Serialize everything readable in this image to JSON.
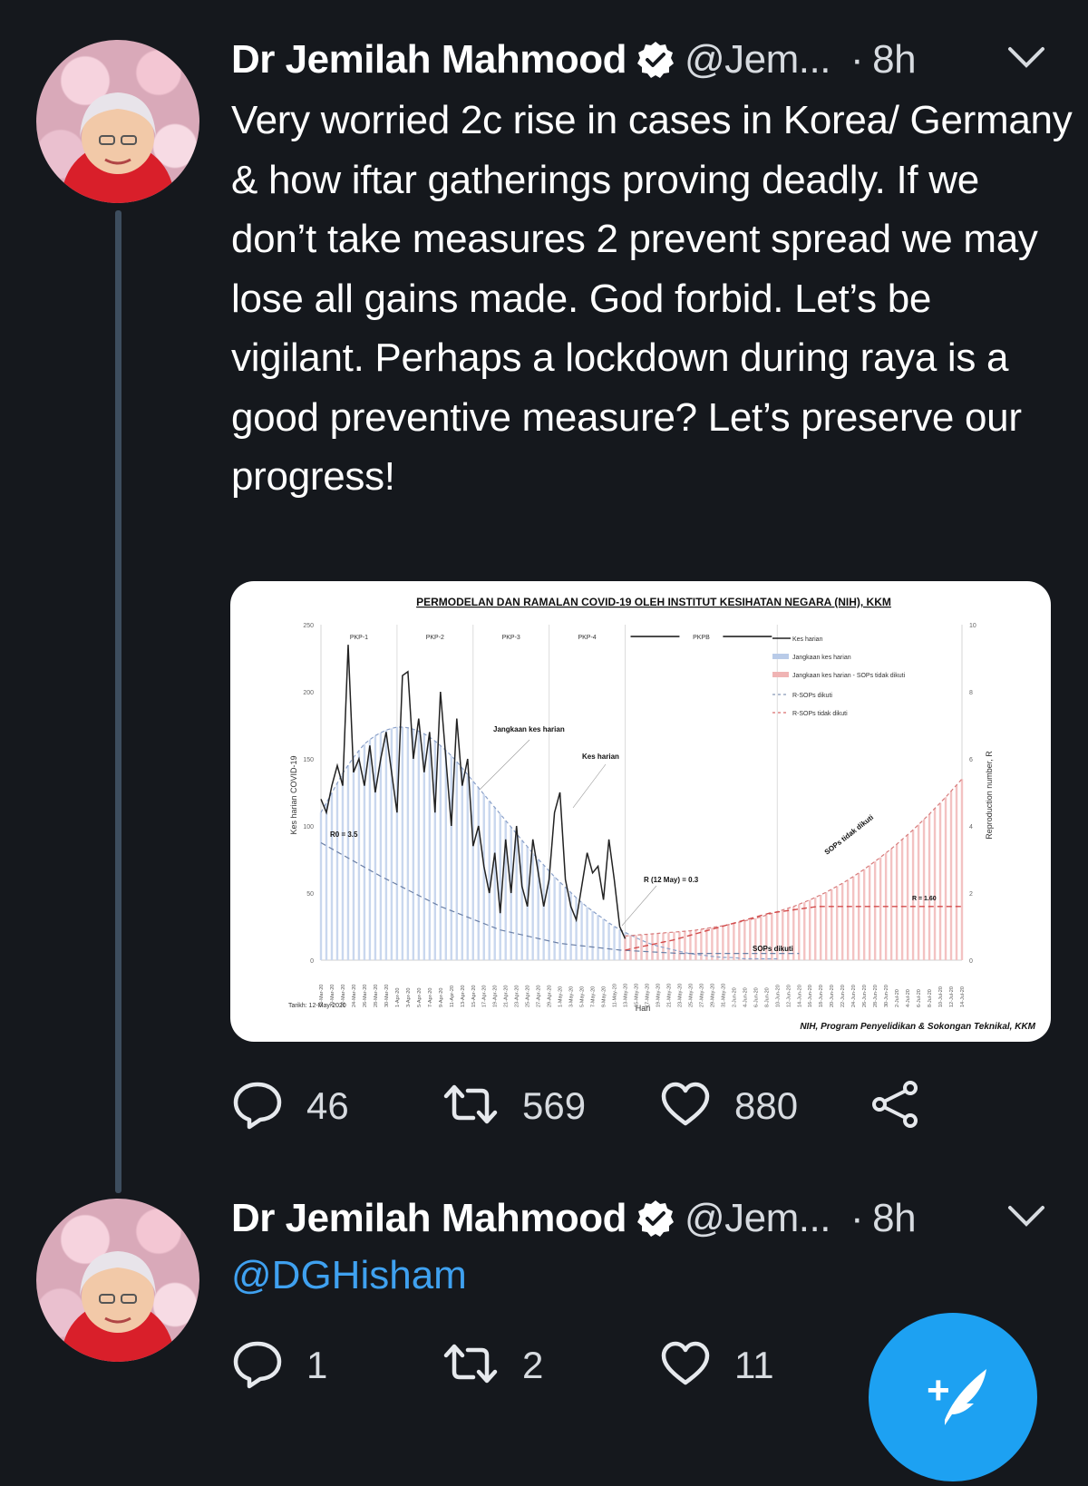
{
  "tweet1": {
    "author_name": "Dr Jemilah Mahmood",
    "handle": "@Jem...",
    "separator": "·",
    "time": "8h",
    "text": "Very worried 2c rise in cases in Korea/ Germany & how iftar gatherings proving deadly. If we don’t take measures 2 prevent spread we may lose all gains made. God forbid. Let’s be vigilant. Perhaps a lockdown during raya is a good preventive measure? Let’s preserve our progress!",
    "replies": "46",
    "retweets": "569",
    "likes": "880"
  },
  "chart": {
    "title": "PERMODELAN DAN RAMALAN COVID-19 OLEH INSTITUT KESIHATAN NEGARA (NIH), KKM",
    "ylabel_left": "Kes harian COVID-19",
    "ylabel_right": "Reproduction number, R",
    "xlabel": "Hari",
    "date_note": "Tarikh: 12-May-2020",
    "source": "NIH, Program Penyelidikan & Sokongan Teknikal, KKM",
    "phases": [
      "PKP-1",
      "PKP-2",
      "PKP-3",
      "PKP-4",
      "PKPB"
    ],
    "legend": [
      "Kes harian",
      "Jangkaan kes harian",
      "Jangkaan kes harian - SOPs tidak dikuti",
      "R-SOPs dikuti",
      "R-SOPs tidak dikuti"
    ],
    "annotations": {
      "r0": "R0 = 3.5",
      "jangkaan": "Jangkaan kes harian",
      "kes": "Kes harian",
      "r_may": "R (12 May) = 0.3",
      "sops_tidak": "SOPs tidak dikuti",
      "r_160": "R = 1.60",
      "sops_dikuti": "SOPs dikuti"
    },
    "left_ticks": [
      "250",
      "200",
      "150",
      "100",
      "50",
      "0"
    ],
    "right_ticks": [
      "10",
      "8",
      "6",
      "4",
      "2",
      "0"
    ],
    "date_ticks": [
      "18-Mar-20",
      "20-Mar-20",
      "22-Mar-20",
      "24-Mar-20",
      "26-Mar-20",
      "28-Mar-20",
      "30-Mar-20",
      "1-Apr-20",
      "3-Apr-20",
      "5-Apr-20",
      "7-Apr-20",
      "9-Apr-20",
      "11-Apr-20",
      "13-Apr-20",
      "15-Apr-20",
      "17-Apr-20",
      "19-Apr-20",
      "21-Apr-20",
      "23-Apr-20",
      "25-Apr-20",
      "27-Apr-20",
      "29-Apr-20",
      "1-May-20",
      "3-May-20",
      "5-May-20",
      "7-May-20",
      "9-May-20",
      "11-May-20",
      "13-May-20",
      "15-May-20",
      "17-May-20",
      "19-May-20",
      "21-May-20",
      "23-May-20",
      "25-May-20",
      "27-May-20",
      "29-May-20",
      "31-May-20",
      "2-Jun-20",
      "4-Jun-20",
      "6-Jun-20",
      "8-Jun-20",
      "10-Jun-20",
      "12-Jun-20",
      "14-Jun-20",
      "16-Jun-20",
      "18-Jun-20",
      "20-Jun-20",
      "22-Jun-20",
      "24-Jun-20",
      "26-Jun-20",
      "28-Jun-20",
      "30-Jun-20",
      "2-Jul-20",
      "4-Jul-20",
      "6-Jul-20",
      "8-Jul-20",
      "10-Jul-20",
      "12-Jul-20",
      "14-Jul-20"
    ]
  },
  "chart_data": {
    "type": "line",
    "title": "PERMODELAN DAN RAMALAN COVID-19 OLEH INSTITUT KESIHATAN NEGARA (NIH), KKM",
    "xlabel": "Hari",
    "ylabel": "Kes harian COVID-19",
    "ylabel_right": "Reproduction number, R",
    "ylim": [
      0,
      250
    ],
    "ylim_right": [
      0,
      10
    ],
    "x_start": "18-Mar-20",
    "x_end": "14-Jul-20",
    "series": [
      {
        "name": "Kes harian",
        "values": [
          120,
          110,
          130,
          145,
          130,
          235,
          140,
          150,
          130,
          160,
          125,
          150,
          170,
          140,
          110,
          212,
          215,
          150,
          180,
          140,
          170,
          110,
          200,
          150,
          100,
          180,
          130,
          150,
          85,
          100,
          70,
          50,
          80,
          35,
          90,
          50,
          100,
          55,
          40,
          90,
          65,
          40,
          60,
          110,
          125,
          60,
          40,
          30,
          55,
          80,
          65,
          70,
          45,
          90,
          60,
          25,
          16
        ]
      },
      {
        "name": "Jangkaan kes harian",
        "values": [
          110,
          125,
          140,
          152,
          162,
          168,
          172,
          174,
          173,
          170,
          165,
          158,
          150,
          140,
          130,
          120,
          110,
          100,
          90,
          80,
          71,
          62,
          54,
          46,
          39,
          33,
          27,
          22,
          18,
          14,
          11,
          9,
          7,
          5,
          4,
          3,
          2,
          2,
          1,
          1,
          1,
          1
        ]
      },
      {
        "name": "Jangkaan kes harian - SOPs tidak dikuti",
        "values": [
          18,
          19,
          20,
          21,
          22,
          24,
          26,
          29,
          32,
          36,
          40,
          45,
          51,
          58,
          66,
          75,
          85,
          96,
          108,
          121,
          135
        ]
      },
      {
        "name": "R-SOPs dikuti",
        "values": [
          3.5,
          2.5,
          1.6,
          0.9,
          0.5,
          0.3,
          0.2,
          0.2,
          0.2
        ]
      },
      {
        "name": "R-SOPs tidak dikuti",
        "values": [
          0.3,
          0.6,
          1.0,
          1.4,
          1.6,
          1.6,
          1.6,
          1.6
        ]
      }
    ]
  },
  "tweet2": {
    "author_name": "Dr Jemilah Mahmood",
    "handle": "@Jem...",
    "separator": "·",
    "time": "8h",
    "mention": "@DGHisham",
    "replies": "1",
    "retweets": "2",
    "likes": "11"
  },
  "compose": {
    "plus": "+"
  }
}
